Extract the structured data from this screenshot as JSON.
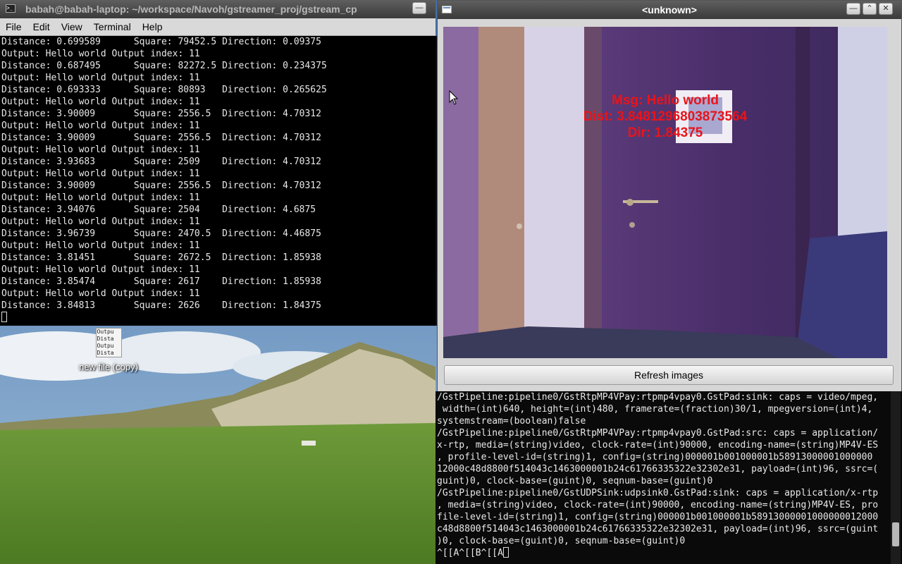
{
  "desktop": {
    "icon": {
      "label": "new file (copy)",
      "preview_lines": [
        "Outpu",
        "Dista",
        "Outpu",
        "Dista"
      ]
    }
  },
  "terminal1": {
    "title": "babah@babah-laptop: ~/workspace/Navoh/gstreamer_proj/gstream_cp",
    "menu": [
      "File",
      "Edit",
      "View",
      "Terminal",
      "Help"
    ],
    "lines": [
      "Distance: 0.699589      Square: 79452.5 Direction: 0.09375",
      "Output: Hello world Output index: 11",
      "Distance: 0.687495      Square: 82272.5 Direction: 0.234375",
      "Output: Hello world Output index: 11",
      "Distance: 0.693333      Square: 80893   Direction: 0.265625",
      "Output: Hello world Output index: 11",
      "Distance: 3.90009       Square: 2556.5  Direction: 4.70312",
      "Output: Hello world Output index: 11",
      "Distance: 3.90009       Square: 2556.5  Direction: 4.70312",
      "Output: Hello world Output index: 11",
      "Distance: 3.93683       Square: 2509    Direction: 4.70312",
      "Output: Hello world Output index: 11",
      "Distance: 3.90009       Square: 2556.5  Direction: 4.70312",
      "Output: Hello world Output index: 11",
      "Distance: 3.94076       Square: 2504    Direction: 4.6875",
      "Output: Hello world Output index: 11",
      "Distance: 3.96739       Square: 2470.5  Direction: 4.46875",
      "Output: Hello world Output index: 11",
      "Distance: 3.81451       Square: 2672.5  Direction: 1.85938",
      "Output: Hello world Output index: 11",
      "Distance: 3.85474       Square: 2617    Direction: 1.85938",
      "Output: Hello world Output index: 11",
      "Distance: 3.84813       Square: 2626    Direction: 1.84375"
    ]
  },
  "viewer": {
    "title": "<unknown>",
    "overlay": {
      "msg": "Msg: Hello world",
      "dist": "Dist: 3.8481296803873564",
      "dir": "Dir: 1.84375"
    },
    "refresh_label": "Refresh images"
  },
  "terminal2": {
    "lines": [
      "/GstPipeline:pipeline0/GstRtpMP4VPay:rtpmp4vpay0.GstPad:sink: caps = video/mpeg,",
      " width=(int)640, height=(int)480, framerate=(fraction)30/1, mpegversion=(int)4,",
      "systemstream=(boolean)false",
      "/GstPipeline:pipeline0/GstRtpMP4VPay:rtpmp4vpay0.GstPad:src: caps = application/",
      "x-rtp, media=(string)video, clock-rate=(int)90000, encoding-name=(string)MP4V-ES",
      ", profile-level-id=(string)1, config=(string)000001b001000001b58913000001000000",
      "12000c48d8800f514043c1463000001b24c61766335322e32302e31, payload=(int)96, ssrc=(",
      "guint)0, clock-base=(guint)0, seqnum-base=(guint)0",
      "/GstPipeline:pipeline0/GstUDPSink:udpsink0.GstPad:sink: caps = application/x-rtp",
      ", media=(string)video, clock-rate=(int)90000, encoding-name=(string)MP4V-ES, pro",
      "file-level-id=(string)1, config=(string)000001b001000001b58913000001000000012000",
      "c48d8800f514043c1463000001b24c61766335322e32302e31, payload=(int)96, ssrc=(guint",
      ")0, clock-base=(guint)0, seqnum-base=(guint)0"
    ],
    "prompt": "^[[A^[[B^[[A"
  },
  "colors": {
    "overlay_text": "#e8141b",
    "terminal_bg": "#000000",
    "terminal_fg": "#e8e8e8"
  }
}
